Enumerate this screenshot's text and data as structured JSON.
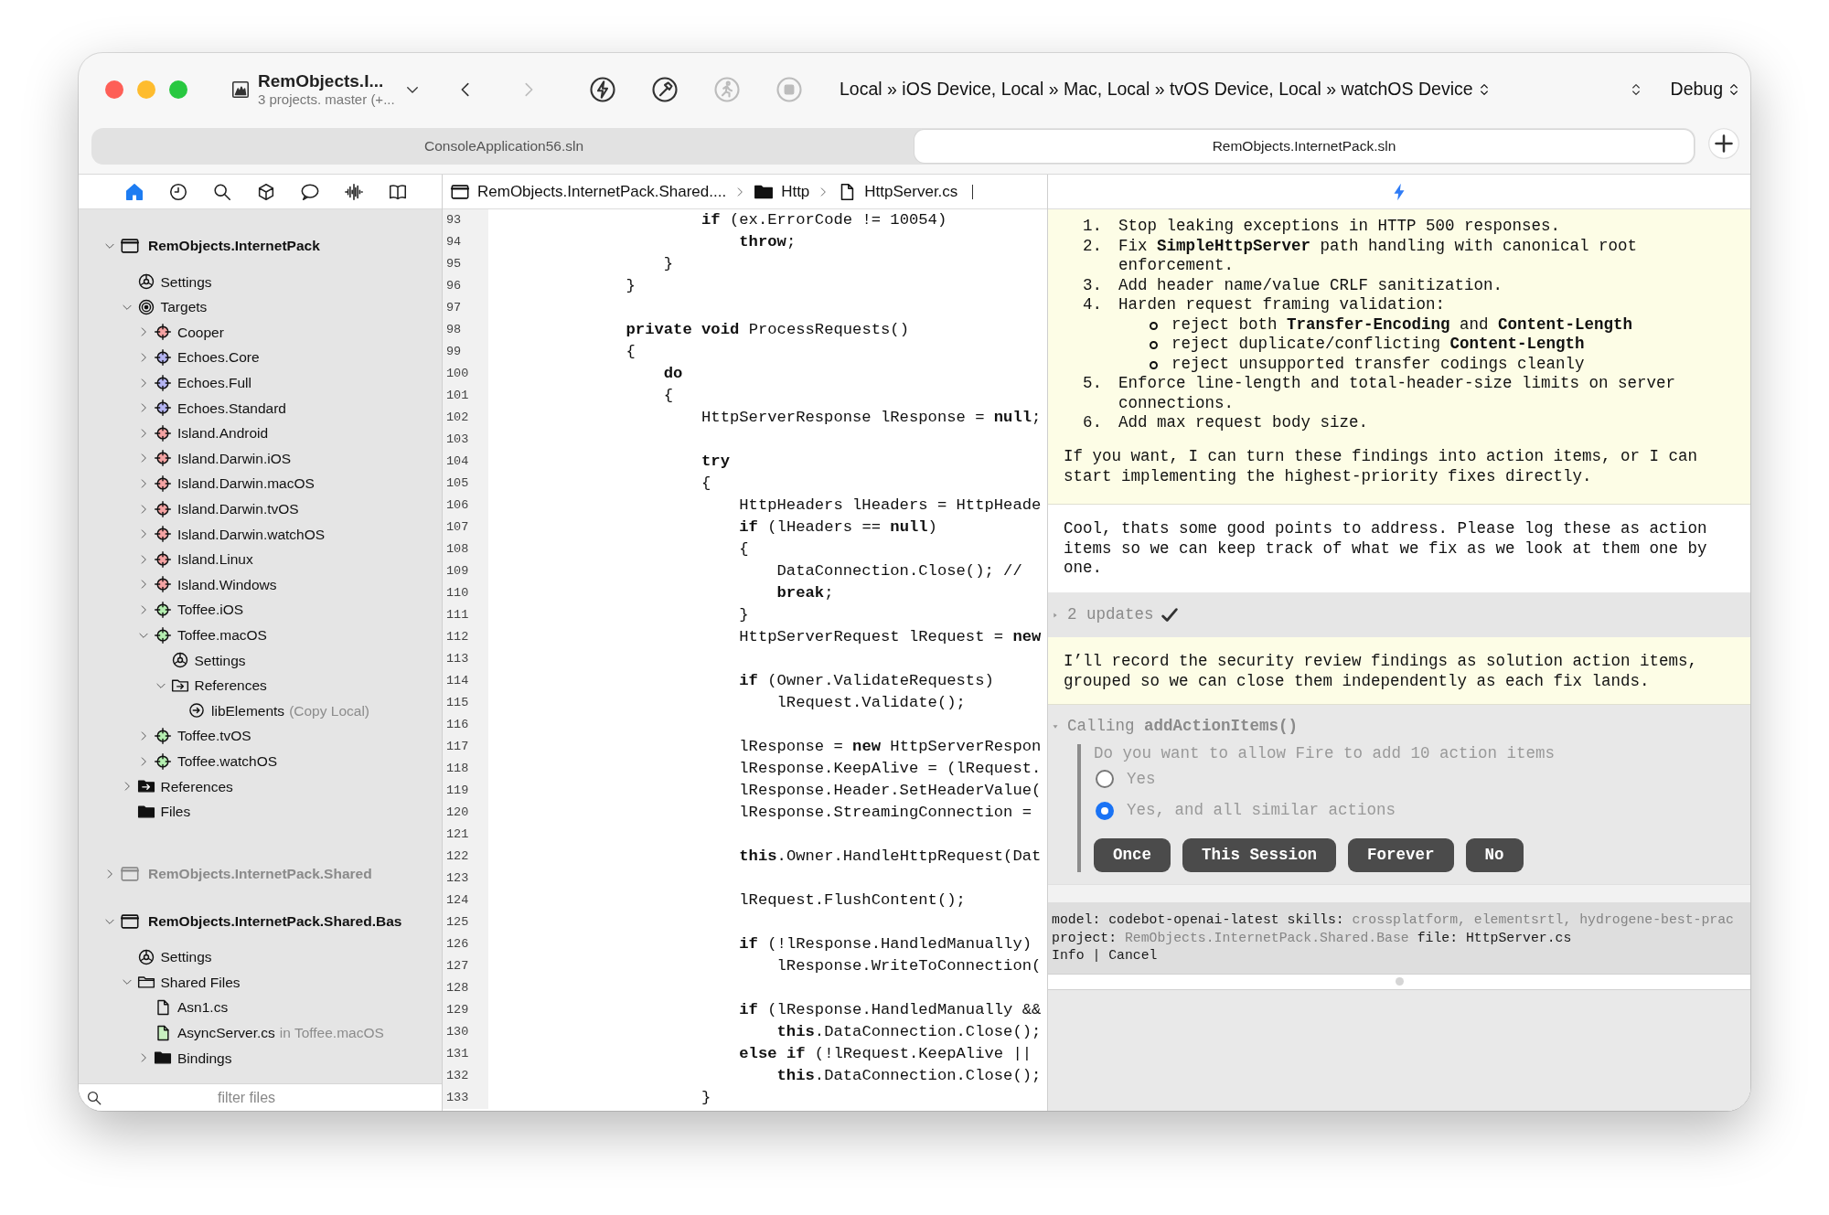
{
  "window": {
    "project_title": "RemObjects.I...",
    "project_subtitle": "3 projects. master (+...",
    "destination": "Local » iOS Device, Local » Mac, Local » tvOS Device, Local » watchOS Device",
    "configuration": "Debug"
  },
  "toolbar_buttons": [
    {
      "kind": "back",
      "disabled": false
    },
    {
      "kind": "forward",
      "disabled": true
    },
    {
      "kind": "build",
      "disabled": false
    },
    {
      "kind": "clean",
      "disabled": false
    },
    {
      "kind": "run",
      "disabled": true
    },
    {
      "kind": "stop",
      "disabled": true
    }
  ],
  "solution_tabs": [
    {
      "label": "ConsoleApplication56.sln",
      "selected": false
    },
    {
      "label": "RemObjects.InternetPack.sln",
      "selected": true
    }
  ],
  "sidebar_tabs": [
    {
      "kind": "home",
      "selected": true
    },
    {
      "kind": "history",
      "selected": false
    },
    {
      "kind": "search",
      "selected": false
    },
    {
      "kind": "package",
      "selected": false
    },
    {
      "kind": "chat",
      "selected": false
    },
    {
      "kind": "waveform",
      "selected": false
    },
    {
      "kind": "book",
      "selected": false
    }
  ],
  "tree": [
    {
      "label": "RemObjects.InternetPack",
      "kind": "project",
      "active": true,
      "expanded": true,
      "children": [
        {
          "label": "Settings",
          "kind": "settings"
        },
        {
          "label": "Targets",
          "kind": "targets",
          "expanded": true,
          "children": [
            {
              "label": "Cooper",
              "kind": "target",
              "color": "#f4a3a3",
              "expanded": false
            },
            {
              "label": "Echoes.Core",
              "kind": "target",
              "color": "#b4b4f2",
              "expanded": false
            },
            {
              "label": "Echoes.Full",
              "kind": "target",
              "color": "#b4b4f2",
              "expanded": false
            },
            {
              "label": "Echoes.Standard",
              "kind": "target",
              "color": "#b4b4f2",
              "expanded": false
            },
            {
              "label": "Island.Android",
              "kind": "target",
              "color": "#f4a3a3",
              "expanded": false
            },
            {
              "label": "Island.Darwin.iOS",
              "kind": "target",
              "color": "#f4a3a3",
              "expanded": false
            },
            {
              "label": "Island.Darwin.macOS",
              "kind": "target",
              "color": "#f4a3a3",
              "expanded": false
            },
            {
              "label": "Island.Darwin.tvOS",
              "kind": "target",
              "color": "#f4a3a3",
              "expanded": false
            },
            {
              "label": "Island.Darwin.watchOS",
              "kind": "target",
              "color": "#f4a3a3",
              "expanded": false
            },
            {
              "label": "Island.Linux",
              "kind": "target",
              "color": "#f4a3a3",
              "expanded": false
            },
            {
              "label": "Island.Windows",
              "kind": "target",
              "color": "#f4a3a3",
              "expanded": false
            },
            {
              "label": "Toffee.iOS",
              "kind": "target",
              "color": "#b4eeb0",
              "expanded": false
            },
            {
              "label": "Toffee.macOS",
              "kind": "target",
              "color": "#b4eeb0",
              "expanded": true,
              "children": [
                {
                  "label": "Settings",
                  "kind": "settings"
                },
                {
                  "label": "References",
                  "kind": "reference-folder",
                  "expanded": true,
                  "children": [
                    {
                      "label": "libElements",
                      "kind": "reference",
                      "note": "(Copy Local)"
                    }
                  ]
                }
              ]
            },
            {
              "label": "Toffee.tvOS",
              "kind": "target",
              "color": "#b4eeb0",
              "expanded": false
            },
            {
              "label": "Toffee.watchOS",
              "kind": "target",
              "color": "#b4eeb0",
              "expanded": false
            }
          ]
        },
        {
          "label": "References",
          "kind": "references",
          "expanded": false
        },
        {
          "label": "Files",
          "kind": "files"
        }
      ]
    },
    {
      "label": "RemObjects.InternetPack.Shared",
      "kind": "project",
      "active": false,
      "expanded": false
    },
    {
      "label": "RemObjects.InternetPack.Shared.Bas",
      "kind": "project",
      "active": true,
      "expanded": true,
      "children": [
        {
          "label": "Settings",
          "kind": "settings"
        },
        {
          "label": "Shared Files",
          "kind": "folder",
          "expanded": true,
          "children": [
            {
              "label": "Asn1.cs",
              "kind": "file"
            },
            {
              "label": "AsyncServer.cs",
              "kind": "linked-file",
              "note": "in Toffee.macOS"
            },
            {
              "label": "Bindings",
              "kind": "files",
              "expanded": false
            }
          ]
        }
      ]
    }
  ],
  "filter": {
    "placeholder": "filter files"
  },
  "breadcrumb": [
    {
      "label": "RemObjects.InternetPack.Shared....",
      "kind": "project"
    },
    {
      "label": "Http",
      "kind": "folder"
    },
    {
      "label": "HttpServer.cs",
      "kind": "file"
    }
  ],
  "editor": {
    "lines": [
      {
        "number": "93",
        "text": "                **if** (ex.ErrorCode != 10054)"
      },
      {
        "number": "94",
        "text": "                    **throw**;"
      },
      {
        "number": "95",
        "text": "            }"
      },
      {
        "number": "96",
        "text": "        }"
      },
      {
        "number": "97"
      },
      {
        "number": "98",
        "text": "        **private** **void** ProcessRequests()"
      },
      {
        "number": "99",
        "text": "        {"
      },
      {
        "number": "100",
        "text": "            **do**"
      },
      {
        "number": "101",
        "text": "            {"
      },
      {
        "number": "102",
        "text": "                HttpServerResponse lResponse = **null**;"
      },
      {
        "number": "103"
      },
      {
        "number": "104",
        "text": "                **try**"
      },
      {
        "number": "105",
        "text": "                {"
      },
      {
        "number": "106",
        "text": "                    HttpHeaders lHeaders = HttpHeade"
      },
      {
        "number": "107",
        "text": "                    **if** (lHeaders == **null**)"
      },
      {
        "number": "108",
        "text": "                    {"
      },
      {
        "number": "109",
        "text": "                        DataConnection.Close(); //"
      },
      {
        "number": "110",
        "text": "                        **break**;"
      },
      {
        "number": "111",
        "text": "                    }"
      },
      {
        "number": "112",
        "text": "                    HttpServerRequest lRequest = **new**"
      },
      {
        "number": "113"
      },
      {
        "number": "114",
        "text": "                    **if** (Owner.ValidateRequests)"
      },
      {
        "number": "115",
        "text": "                        lRequest.Validate();"
      },
      {
        "number": "116"
      },
      {
        "number": "117",
        "text": "                    lResponse = **new** HttpServerRespon"
      },
      {
        "number": "118",
        "text": "                    lResponse.KeepAlive = (lRequest."
      },
      {
        "number": "119",
        "text": "                    lResponse.Header.SetHeaderValue("
      },
      {
        "number": "120",
        "text": "                    lResponse.StreamingConnection ="
      },
      {
        "number": "121"
      },
      {
        "number": "122",
        "text": "                    **this**.Owner.HandleHttpRequest(Dat"
      },
      {
        "number": "123"
      },
      {
        "number": "124",
        "text": "                    lRequest.FlushContent();"
      },
      {
        "number": "125"
      },
      {
        "number": "126",
        "text": "                    **if** (!lResponse.HandledManually)"
      },
      {
        "number": "127",
        "text": "                        lResponse.WriteToConnection("
      },
      {
        "number": "128"
      },
      {
        "number": "129",
        "text": "                    **if** (lResponse.HandledManually &&"
      },
      {
        "number": "130",
        "text": "                        **this**.DataConnection.Close();"
      },
      {
        "number": "131",
        "text": "                    **else** **if** (!lRequest.KeepAlive ||"
      },
      {
        "number": "132",
        "text": "                        **this**.DataConnection.Close();"
      },
      {
        "number": "133",
        "text": "                }"
      }
    ]
  },
  "chat": {
    "messages": [
      {
        "kind": "assistant",
        "list": [
          {
            "number": "1.",
            "text": "Stop leaking exceptions in HTTP 500 responses."
          },
          {
            "number": "2.",
            "text": "Fix **SimpleHttpServer** path handling with canonical root enforcement."
          },
          {
            "number": "3.",
            "text": "Add header name/value CRLF sanitization."
          },
          {
            "number": "4.",
            "text": "Harden request framing validation:",
            "children": [
              {
                "text": "reject both **Transfer-Encoding** and **Content-Length**"
              },
              {
                "text": "reject duplicate/conflicting **Content-Length**"
              },
              {
                "text": "reject unsupported transfer codings cleanly"
              }
            ]
          },
          {
            "number": "5.",
            "text": "Enforce line-length and total-header-size limits on server connections."
          },
          {
            "number": "6.",
            "text": "Add max request body size."
          }
        ],
        "paragraph": "If you want, I can turn these findings into action items, or I can start implementing the highest-priority fixes directly."
      },
      {
        "kind": "user",
        "paragraph": "Cool, thats some good points to address. Please log these as action items so we can keep track of what we fix as we look at them one by one."
      },
      {
        "kind": "updates",
        "text": "2 updates",
        "expanded": false
      },
      {
        "kind": "assistant",
        "paragraph": "I’ll record the security review findings as solution action items, grouped so we can close them independently as each fix lands."
      },
      {
        "kind": "tool-call",
        "expanded": true,
        "title": "Calling **addActionItems()**",
        "question": "Do you want to allow Fire to add 10 action items",
        "options": [
          {
            "label": "Yes",
            "selected": false
          },
          {
            "label": "Yes, and all similar actions",
            "selected": true
          }
        ],
        "buttons": [
          "Once",
          "This Session",
          "Forever",
          "No"
        ]
      }
    ],
    "status": [
      [
        {
          "kind": "label",
          "text": "model:"
        },
        {
          "kind": "value",
          "text": "codebot-openai-latest"
        },
        {
          "kind": "label",
          "text": "skills:"
        },
        {
          "kind": "muted",
          "text": "crossplatform, elementsrtl, hydrogene-best-prac"
        }
      ],
      [
        {
          "kind": "label",
          "text": "project:"
        },
        {
          "kind": "muted",
          "text": "RemObjects.InternetPack.Shared.Base"
        },
        {
          "kind": "label",
          "text": "file:"
        },
        {
          "kind": "value",
          "text": "HttpServer.cs"
        }
      ],
      [
        {
          "kind": "link",
          "text": "Info"
        },
        {
          "kind": "separator",
          "text": "|"
        },
        {
          "kind": "link",
          "text": "Cancel"
        }
      ]
    ]
  }
}
